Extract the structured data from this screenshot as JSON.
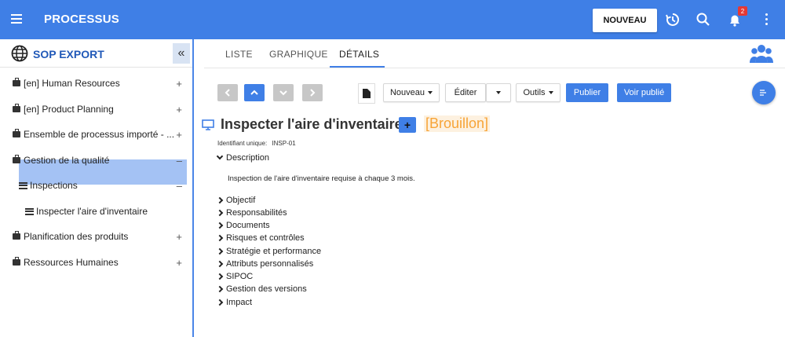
{
  "app": {
    "title": "PROCESSUS",
    "new_button": "NOUVEAU",
    "notifications_count": "2"
  },
  "sidebar": {
    "title": "SOP EXPORT",
    "items": [
      {
        "label": "[en] Human Resources",
        "toggle": "+"
      },
      {
        "label": "[en] Product Planning",
        "toggle": "+"
      },
      {
        "label": "Ensemble de processus importé - ...",
        "toggle": "+"
      },
      {
        "label": "Gestion de la qualité",
        "toggle": "–"
      },
      {
        "label": "Inspections",
        "toggle": "–"
      },
      {
        "label": "Inspecter l'aire d'inventaire",
        "toggle": ""
      },
      {
        "label": "Planification des produits",
        "toggle": "+"
      },
      {
        "label": "Ressources Humaines",
        "toggle": "+"
      }
    ]
  },
  "tabs": [
    "LISTE",
    "GRAPHIQUE",
    "DÉTAILS"
  ],
  "toolbar": {
    "nouveau": "Nouveau",
    "editer": "Éditer",
    "outils": "Outils",
    "publier": "Publier",
    "voir_publie": "Voir publié"
  },
  "detail": {
    "title": "Inspecter l'aire d'inventaire",
    "status": "[Brouillon]",
    "uid_label": "Identifiant unique:",
    "uid_value": "INSP-01",
    "description_label": "Description",
    "description_text": "Inspection de l'aire d'inventaire requise à chaque 3 mois.",
    "sections": [
      "Objectif",
      "Responsabilités",
      "Documents",
      "Risques et contrôles",
      "Stratégie et performance",
      "Attributs personnalisés",
      "SIPOC",
      "Gestion des versions",
      "Impact"
    ]
  },
  "colors": {
    "primary": "#3f7fe6",
    "selected": "#a4c2f4",
    "draft": "#f7a437"
  }
}
